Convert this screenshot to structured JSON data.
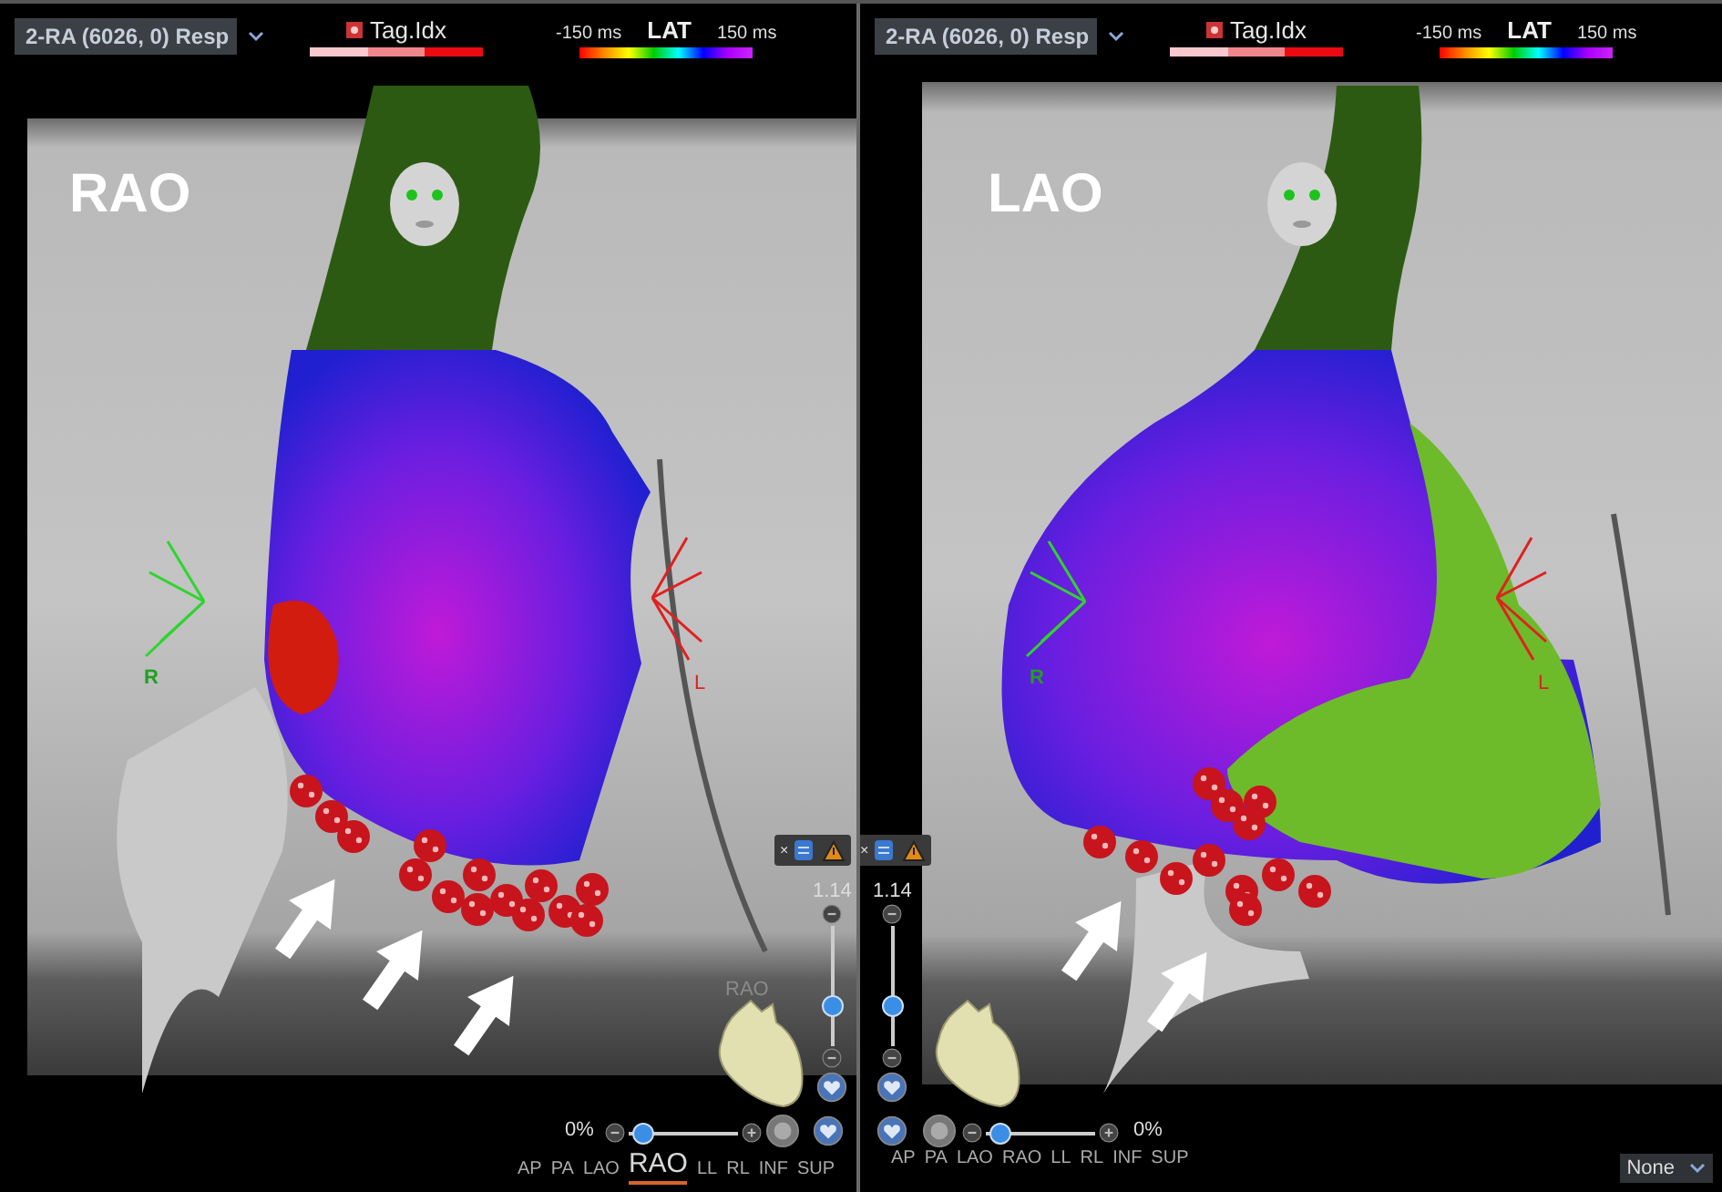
{
  "panels": [
    {
      "map_selector": "2-RA (6026, 0) Resp",
      "tag_legend": {
        "label": "Tag.Idx"
      },
      "lat_legend": {
        "min": "-150 ms",
        "label": "LAT",
        "max": "150 ms"
      },
      "view_label": "RAO",
      "orientation": {
        "right": "R",
        "left": "L"
      },
      "fluoro_label": "RAO",
      "overlay_close": "×",
      "zoom": "1.14",
      "zoom_slider": {
        "level": 0.3
      },
      "transparency": {
        "reading": "0%",
        "level": 0.05
      },
      "views": [
        {
          "label": "AP",
          "selected": false
        },
        {
          "label": "PA",
          "selected": false
        },
        {
          "label": "LAO",
          "selected": false
        },
        {
          "label": "RAO",
          "selected": true
        },
        {
          "label": "LL",
          "selected": false
        },
        {
          "label": "RL",
          "selected": false
        },
        {
          "label": "INF",
          "selected": false
        },
        {
          "label": "SUP",
          "selected": false
        }
      ]
    },
    {
      "map_selector": "2-RA (6026, 0) Resp",
      "tag_legend": {
        "label": "Tag.Idx"
      },
      "lat_legend": {
        "min": "-150 ms",
        "label": "LAT",
        "max": "150 ms"
      },
      "view_label": "LAO",
      "orientation": {
        "right": "R",
        "left": "L"
      },
      "overlay_close": "×",
      "zoom": "1.14",
      "zoom_slider": {
        "level": 0.3
      },
      "transparency": {
        "reading": "0%",
        "level": 0.05
      },
      "display_filter": "None",
      "views": [
        {
          "label": "AP",
          "selected": false
        },
        {
          "label": "PA",
          "selected": false
        },
        {
          "label": "LAO",
          "selected": false
        },
        {
          "label": "RAO",
          "selected": false
        },
        {
          "label": "LL",
          "selected": false
        },
        {
          "label": "RL",
          "selected": false
        },
        {
          "label": "INF",
          "selected": false
        },
        {
          "label": "SUP",
          "selected": false
        }
      ]
    }
  ]
}
